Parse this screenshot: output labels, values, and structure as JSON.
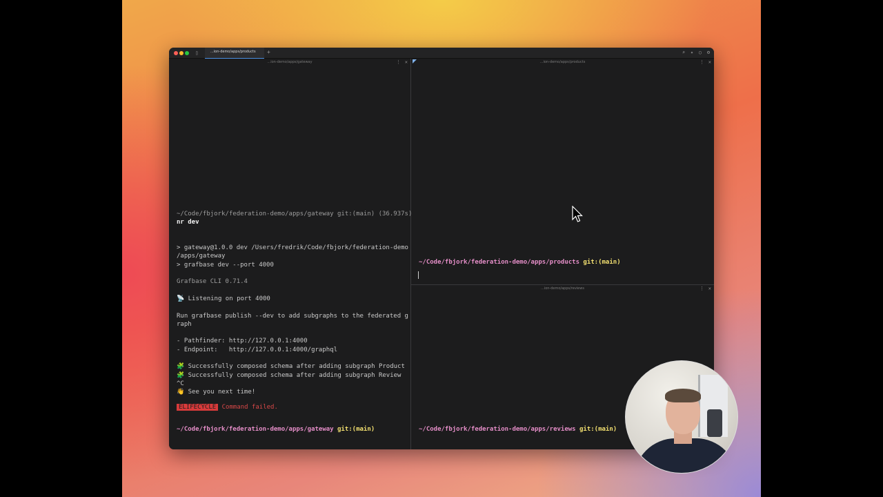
{
  "window": {
    "tab_title": "...ion-demo/apps/products",
    "new_tab_glyph": "+"
  },
  "panes": {
    "left": {
      "title": "...ion-demo/apps/gateway",
      "lines": [
        {
          "text": "~/Code/fbjork/federation-demo/apps/gateway git:(main) (36.937s)",
          "style": "dim"
        },
        {
          "text": "nr dev",
          "style": "bold"
        },
        {
          "text": "",
          "style": ""
        },
        {
          "text": "",
          "style": ""
        },
        {
          "text": "> gateway@1.0.0 dev /Users/fredrik/Code/fbjork/federation-demo",
          "style": ""
        },
        {
          "text": "/apps/gateway",
          "style": ""
        },
        {
          "text": "> grafbase dev --port 4000",
          "style": ""
        },
        {
          "text": "",
          "style": ""
        },
        {
          "text": "Grafbase CLI 0.71.4",
          "style": "dim"
        },
        {
          "text": "",
          "style": ""
        },
        {
          "text": "📡 Listening on port 4000",
          "style": ""
        },
        {
          "text": "",
          "style": ""
        },
        {
          "text": "Run grafbase publish --dev to add subgraphs to the federated g",
          "style": ""
        },
        {
          "text": "raph",
          "style": ""
        },
        {
          "text": "",
          "style": ""
        },
        {
          "text": "- Pathfinder: http://127.0.0.1:4000",
          "style": ""
        },
        {
          "text": "- Endpoint:   http://127.0.0.1:4000/graphql",
          "style": ""
        },
        {
          "text": "",
          "style": ""
        },
        {
          "text": "🧩 Successfully composed schema after adding subgraph Product",
          "style": ""
        },
        {
          "text": "🧩 Successfully composed schema after adding subgraph Review",
          "style": ""
        },
        {
          "text": "^C",
          "style": ""
        },
        {
          "text": "👋 See you next time!",
          "style": ""
        }
      ],
      "error_badge": "ELIFECYCLE",
      "error_text": "Command failed.",
      "prompt_path": "~/Code/fbjork/federation-demo/apps/gateway",
      "prompt_git": "git:(main)"
    },
    "top_right": {
      "title": "...ion-demo/apps/products",
      "prompt_path": "~/Code/fbjork/federation-demo/apps/products",
      "prompt_git": "git:(main)"
    },
    "bottom_right": {
      "title": "...ion-demo/apps/reviews",
      "prompt_path": "~/Code/fbjork/federation-demo/apps/reviews",
      "prompt_git": "git:(main)"
    }
  },
  "icons": {
    "titlebar": [
      "search-icon",
      "sparkle-icon",
      "bulb-icon",
      "settings-icon"
    ]
  },
  "colors": {
    "prompt_path": "#e58ec8",
    "prompt_git": "#f3e070",
    "error": "#d83a3a",
    "terminal_bg": "#1c1c1d"
  }
}
